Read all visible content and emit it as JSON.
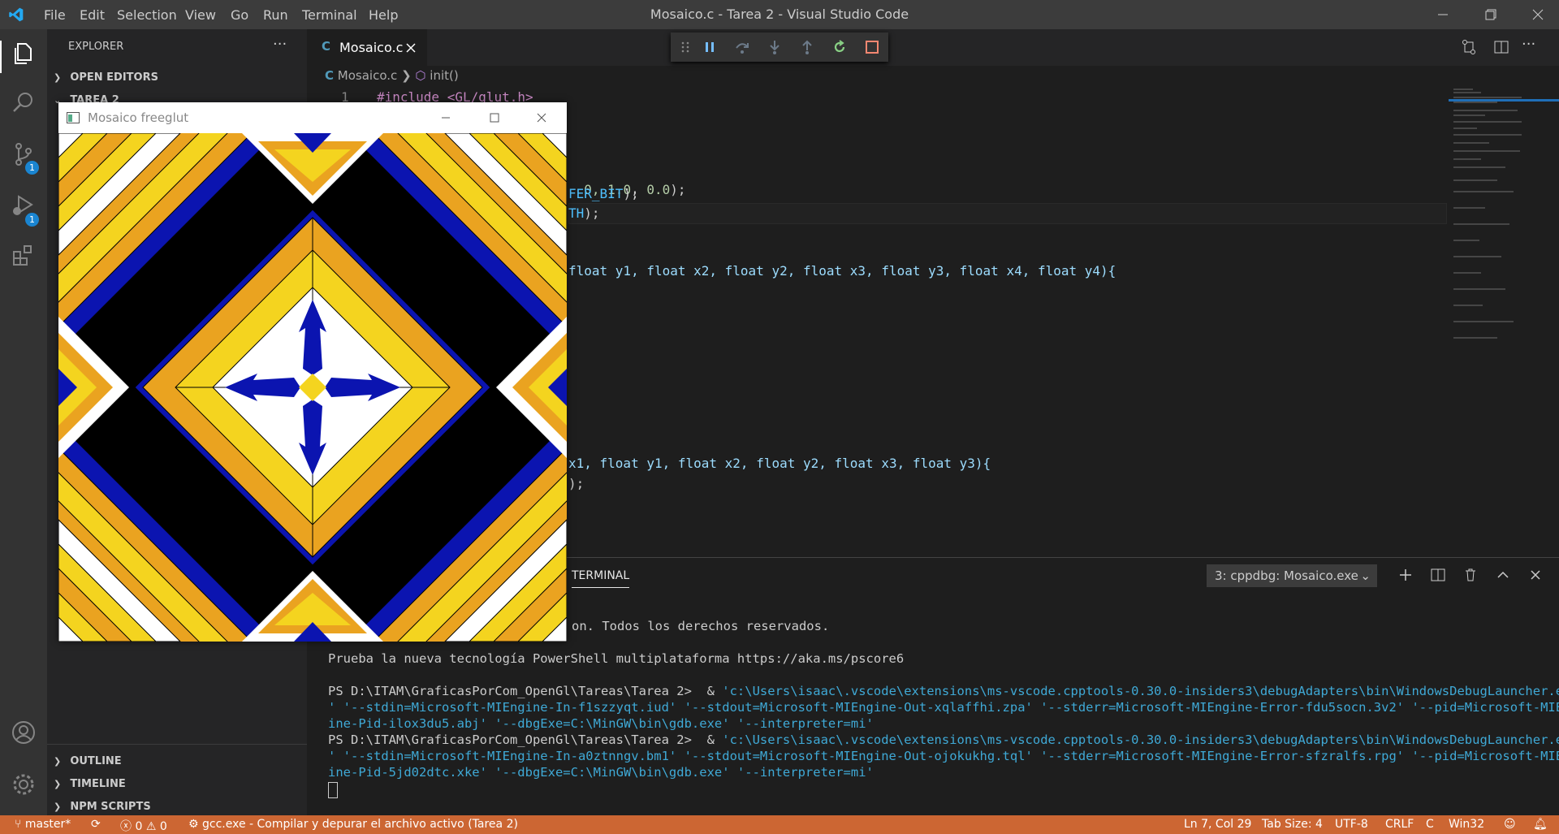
{
  "menu": [
    "File",
    "Edit",
    "Selection",
    "View",
    "Go",
    "Run",
    "Terminal",
    "Help"
  ],
  "window_title": "Mosaico.c - Tarea 2 - Visual Studio Code",
  "activity": {
    "scm_badge": "1",
    "debug_badge": "1"
  },
  "sidebar": {
    "title": "EXPLORER",
    "more": "···",
    "sections": {
      "open_editors": "OPEN EDITORS",
      "folder": "TAREA 2",
      "outline": "OUTLINE",
      "timeline": "TIMELINE",
      "npm": "NPM SCRIPTS"
    }
  },
  "editor": {
    "tab_label": "Mosaico.c",
    "tab_lang": "C",
    "breadcrumb_file": "Mosaico.c",
    "breadcrumb_symbol": "init()",
    "line_number_1": "1",
    "line1": "#include <GL/glut.h>",
    "code": {
      "l5a": "0, ",
      "l5b": "1.0",
      "l5c": ", ",
      "l5d": "0.0",
      "l5e": ");",
      "l6": "FER_BIT",
      "l7": "TH",
      "l10": "float y1, float x2, float y2, float x3, float y3, float x4, float y4){",
      "l20": "x1, float y1, float x2, float y2, float x3, float y3){"
    }
  },
  "glut": {
    "title": "Mosaico freeglut"
  },
  "panel": {
    "tab": "TERMINAL",
    "terminal_select": "3: cppdbg: Mosaico.exe",
    "lines": {
      "l1": "on. Todos los derechos reservados.",
      "l2": "Prueba la nueva tecnología PowerShell multiplataforma https://aka.ms/pscore6",
      "p1": "PS D:\\ITAM\\GraficasPorCom_OpenGl\\Tareas\\Tarea 2>  & ",
      "q1a": "'c:\\Users\\isaac\\.vscode\\extensions\\ms-vscode.cpptools-0.30.0-insiders3\\debugAdapters\\bin\\WindowsDebugLauncher.exe",
      "q1b": "' '--stdin=Microsoft-MIEngine-In-f1szzyqt.iud' '--stdout=Microsoft-MIEngine-Out-xqlaffhi.zpa' '--stderr=Microsoft-MIEngine-Error-fdu5socn.3v2' '--pid=Microsoft-MIEng",
      "q1c": "ine-Pid-ilox3du5.abj' '--dbgExe=C:\\MinGW\\bin\\gdb.exe' '--interpreter=mi'",
      "p2": "PS D:\\ITAM\\GraficasPorCom_OpenGl\\Tareas\\Tarea 2>  & ",
      "q2a": "'c:\\Users\\isaac\\.vscode\\extensions\\ms-vscode.cpptools-0.30.0-insiders3\\debugAdapters\\bin\\WindowsDebugLauncher.exe",
      "q2b": "' '--stdin=Microsoft-MIEngine-In-a0ztnngv.bm1' '--stdout=Microsoft-MIEngine-Out-ojokukhg.tql' '--stderr=Microsoft-MIEngine-Error-sfzralfs.rpg' '--pid=Microsoft-MIEng",
      "q2c": "ine-Pid-5jd02dtc.xke' '--dbgExe=C:\\MinGW\\bin\\gdb.exe' '--interpreter=mi'"
    }
  },
  "status": {
    "branch": "master*",
    "errors": "0",
    "warnings": "0",
    "task": "gcc.exe - Compilar y depurar el archivo activo (Tarea 2)",
    "position": "Ln 7, Col 29",
    "tabsize": "Tab Size: 4",
    "encoding": "UTF-8",
    "eol": "CRLF",
    "language": "C",
    "platform": "Win32"
  },
  "colors": {
    "accent": "#007acc",
    "status_bg": "#cc6633",
    "tile_yellow": "#f4d41f",
    "tile_orange": "#eaa320",
    "tile_blue": "#0b14b0"
  }
}
